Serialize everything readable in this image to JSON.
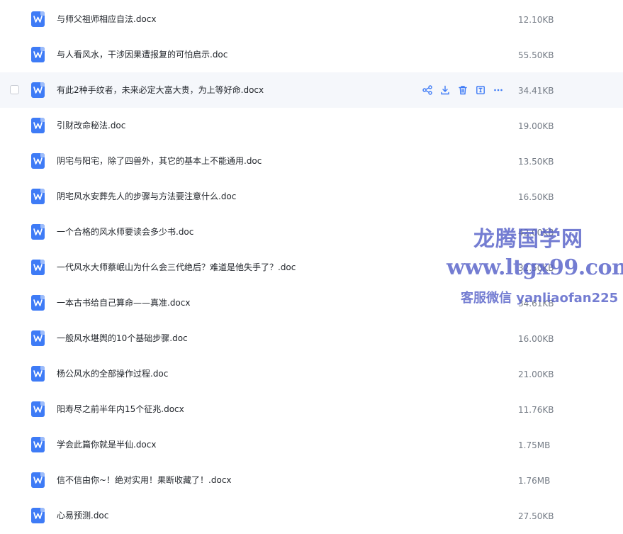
{
  "files": [
    {
      "name": "与师父祖师相应自法.docx",
      "size": "12.10KB"
    },
    {
      "name": "与人看风水，干涉因果遭报复的可怕启示.doc",
      "size": "55.50KB"
    },
    {
      "name": "有此2种手纹者，未来必定大富大贵，为上等好命.docx",
      "size": "34.41KB",
      "hovered": true
    },
    {
      "name": "引财改命秘法.doc",
      "size": "19.00KB"
    },
    {
      "name": "阴宅与阳宅，除了四兽外，其它的基本上不能通用.doc",
      "size": "13.50KB"
    },
    {
      "name": "阴宅风水安葬先人的步骤与方法要注意什么.doc",
      "size": "16.50KB"
    },
    {
      "name": "一个合格的风水师要读会多少书.doc",
      "size": "42.00KB"
    },
    {
      "name": "一代风水大师蔡岷山为什么会三代绝后？难道是他失手了？.doc",
      "size": "32.50KB"
    },
    {
      "name": "一本古书给自己算命——真准.docx",
      "size": "34.61KB"
    },
    {
      "name": "一般风水堪舆的10个基础步骤.doc",
      "size": "16.00KB"
    },
    {
      "name": "杨公风水的全部操作过程.doc",
      "size": "21.00KB"
    },
    {
      "name": "阳寿尽之前半年内15个征兆.docx",
      "size": "11.76KB"
    },
    {
      "name": "学会此篇你就是半仙.docx",
      "size": "1.75MB"
    },
    {
      "name": "信不信由你~！绝对实用！果断收藏了！.docx",
      "size": "1.76MB"
    },
    {
      "name": "心易预测.doc",
      "size": "27.50KB"
    }
  ],
  "row_actions": [
    {
      "icon": "share-icon"
    },
    {
      "icon": "download-icon"
    },
    {
      "icon": "trash-icon"
    },
    {
      "icon": "rename-icon"
    },
    {
      "icon": "more-icon"
    }
  ],
  "watermark": {
    "line1": "龙腾国学网",
    "line2": "www.ltgx99.com",
    "line3": "客服微信 yanliaofan225"
  },
  "colors": {
    "accent": "#3e7bf6",
    "hover_bg": "#f5f7fb",
    "text": "#1f2329",
    "muted": "#747b85",
    "watermark": "#5660c8"
  }
}
